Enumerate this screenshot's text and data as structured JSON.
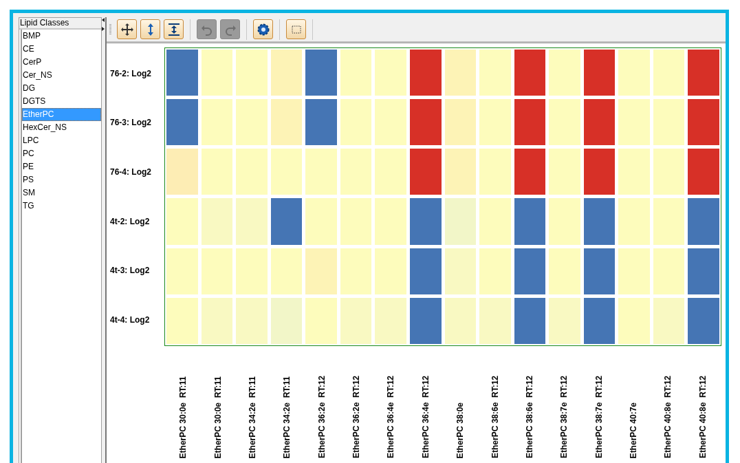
{
  "sidebar": {
    "header": "Lipid Classes",
    "items": [
      {
        "label": "BMP",
        "selected": false
      },
      {
        "label": "CE",
        "selected": false
      },
      {
        "label": "CerP",
        "selected": false
      },
      {
        "label": "Cer_NS",
        "selected": false
      },
      {
        "label": "DG",
        "selected": false
      },
      {
        "label": "DGTS",
        "selected": false
      },
      {
        "label": "EtherPC",
        "selected": true
      },
      {
        "label": "HexCer_NS",
        "selected": false
      },
      {
        "label": "LPC",
        "selected": false
      },
      {
        "label": "PC",
        "selected": false
      },
      {
        "label": "PE",
        "selected": false
      },
      {
        "label": "PS",
        "selected": false
      },
      {
        "label": "SM",
        "selected": false
      },
      {
        "label": "TG",
        "selected": false
      }
    ]
  },
  "toolbar": [
    {
      "buttons": [
        {
          "kind": "pan",
          "disabled": false
        },
        {
          "kind": "zoom-vertical",
          "disabled": false
        },
        {
          "kind": "fit-vertical",
          "disabled": false
        }
      ]
    },
    {
      "buttons": [
        {
          "kind": "undo",
          "disabled": true
        },
        {
          "kind": "redo",
          "disabled": true
        }
      ]
    },
    {
      "buttons": [
        {
          "kind": "settings",
          "disabled": false
        }
      ]
    },
    {
      "buttons": [
        {
          "kind": "select",
          "disabled": false
        }
      ]
    }
  ],
  "heatmap": {
    "columns": [
      "EtherPC 30:0e  RT:11",
      "EtherPC 30:0e  RT:11",
      "EtherPC 34:2e  RT:11",
      "EtherPC 34:2e  RT:11",
      "EtherPC 36:2e  RT:12",
      "EtherPC 36:2e  RT:12",
      "EtherPC 36:4e  RT:12",
      "EtherPC 36:4e  RT:12",
      "EtherPC 38:0e",
      "EtherPC 38:6e  RT:12",
      "EtherPC 38:6e  RT:12",
      "EtherPC 38:7e  RT:12",
      "EtherPC 38:7e  RT:12",
      "EtherPC 40:7e",
      "EtherPC 40:8e  RT:12",
      "EtherPC 40:8e  RT:12"
    ],
    "rows": [
      {
        "label": "76-2: Log2",
        "cells": [
          {
            "color": "#4575b4"
          },
          {
            "color": "#fdfcbc"
          },
          {
            "color": "#fdfcbc"
          },
          {
            "color": "#fdf3b6"
          },
          {
            "color": "#4575b4"
          },
          {
            "color": "#fdfcbc"
          },
          {
            "color": "#fdfcbc"
          },
          {
            "color": "#d73027"
          },
          {
            "color": "#fdf3b6"
          },
          {
            "color": "#fdfcbc"
          },
          {
            "color": "#d73027"
          },
          {
            "color": "#fdfcbc"
          },
          {
            "color": "#d73027"
          },
          {
            "color": "#fdfcbc"
          },
          {
            "color": "#fdfcbc"
          },
          {
            "color": "#d73027"
          }
        ]
      },
      {
        "label": "76-3: Log2",
        "cells": [
          {
            "color": "#4575b4"
          },
          {
            "color": "#fdfcbc"
          },
          {
            "color": "#fdfcbc"
          },
          {
            "color": "#fdf3b6"
          },
          {
            "color": "#4575b4"
          },
          {
            "color": "#fdfcbc"
          },
          {
            "color": "#fdfcbc"
          },
          {
            "color": "#d73027"
          },
          {
            "color": "#fdf3b6"
          },
          {
            "color": "#fdfcbc"
          },
          {
            "color": "#d73027"
          },
          {
            "color": "#fdfcbc"
          },
          {
            "color": "#d73027"
          },
          {
            "color": "#fdfcbc"
          },
          {
            "color": "#fdfcbc"
          },
          {
            "color": "#d73027"
          }
        ]
      },
      {
        "label": "76-4: Log2",
        "cells": [
          {
            "color": "#fdedb4"
          },
          {
            "color": "#fdfcbc"
          },
          {
            "color": "#fdfcbc"
          },
          {
            "color": "#fdfcbc"
          },
          {
            "color": "#fdfcbc"
          },
          {
            "color": "#fdfcbc"
          },
          {
            "color": "#fdfcbc"
          },
          {
            "color": "#d73027"
          },
          {
            "color": "#fdf3b6"
          },
          {
            "color": "#fdfcbc"
          },
          {
            "color": "#d73027"
          },
          {
            "color": "#fdfcbc"
          },
          {
            "color": "#d73027"
          },
          {
            "color": "#fdfcbc"
          },
          {
            "color": "#fdfcbc"
          },
          {
            "color": "#d73027"
          }
        ]
      },
      {
        "label": "4t-2: Log2",
        "cells": [
          {
            "color": "#fdfcbc"
          },
          {
            "color": "#f9f9c2"
          },
          {
            "color": "#f9f9c2"
          },
          {
            "color": "#4575b4"
          },
          {
            "color": "#fdfcbc"
          },
          {
            "color": "#fdfcbc"
          },
          {
            "color": "#fdfcbc"
          },
          {
            "color": "#4575b4"
          },
          {
            "color": "#f2f6c8"
          },
          {
            "color": "#fdfcbc"
          },
          {
            "color": "#4575b4"
          },
          {
            "color": "#fdfcbc"
          },
          {
            "color": "#4575b4"
          },
          {
            "color": "#fdfcbc"
          },
          {
            "color": "#fdfcbc"
          },
          {
            "color": "#4575b4"
          }
        ]
      },
      {
        "label": "4t-3: Log2",
        "cells": [
          {
            "color": "#fdfcbc"
          },
          {
            "color": "#fdfcbc"
          },
          {
            "color": "#fdfcbc"
          },
          {
            "color": "#fdfcbc"
          },
          {
            "color": "#fdf3b6"
          },
          {
            "color": "#fdfcbc"
          },
          {
            "color": "#fdfcbc"
          },
          {
            "color": "#4575b4"
          },
          {
            "color": "#f9f9c2"
          },
          {
            "color": "#fdfcbc"
          },
          {
            "color": "#4575b4"
          },
          {
            "color": "#fdfcbc"
          },
          {
            "color": "#4575b4"
          },
          {
            "color": "#fdfcbc"
          },
          {
            "color": "#fdfcbc"
          },
          {
            "color": "#4575b4"
          }
        ]
      },
      {
        "label": "4t-4: Log2",
        "cells": [
          {
            "color": "#fdfcbc"
          },
          {
            "color": "#f9f9c2"
          },
          {
            "color": "#f9f9c2"
          },
          {
            "color": "#f2f6c8"
          },
          {
            "color": "#fdfcbc"
          },
          {
            "color": "#f9f9c2"
          },
          {
            "color": "#f9f9c2"
          },
          {
            "color": "#4575b4"
          },
          {
            "color": "#f9f9c2"
          },
          {
            "color": "#f9f9c2"
          },
          {
            "color": "#4575b4"
          },
          {
            "color": "#f9f9c2"
          },
          {
            "color": "#4575b4"
          },
          {
            "color": "#fdfcbc"
          },
          {
            "color": "#f9f9c2"
          },
          {
            "color": "#4575b4"
          }
        ]
      }
    ]
  }
}
